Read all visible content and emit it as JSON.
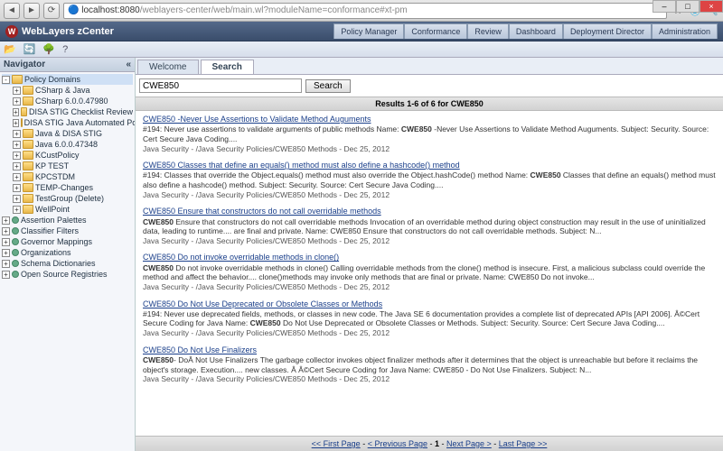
{
  "browser": {
    "url_host": "localhost:8080",
    "url_path": "/weblayers-center/web/main.wl?moduleName=conformance#xt-pm"
  },
  "app": {
    "title": "WebLayers zCenter",
    "tabs": [
      "Policy Manager",
      "Conformance",
      "Review",
      "Dashboard",
      "Deployment Director",
      "Administration"
    ]
  },
  "sidebar": {
    "title": "Navigator",
    "root": "Policy Domains",
    "items": [
      "CSharp & Java",
      "CSharp 6.0.0.47980",
      "DISA STIG Checklist Review",
      "DISA STIG Java Automated Policies v",
      "Java & DISA STIG",
      "Java 6.0.0.47348",
      "KCustPolicy",
      "KP TEST",
      "KPCSTDM",
      "TEMP-Changes",
      "TestGroup (Delete)",
      "WellPoint"
    ],
    "bottom": [
      "Assertion Palettes",
      "Classifier Filters",
      "Governor Mappings",
      "Organizations",
      "Schema Dictionaries",
      "Open Source Registries"
    ]
  },
  "content": {
    "tabs": {
      "welcome": "Welcome",
      "search": "Search"
    },
    "search_value": "CWE850",
    "search_btn": "Search",
    "results_header": "Results 1-6 of 6 for CWE850",
    "results": [
      {
        "title": "CWE850 -Never Use Assertions to Validate Method Auguments",
        "summary_pre": "#194: Never use assertions to validate arguments of public methods Name: ",
        "summary_bold": "CWE850",
        "summary_post": " -Never Use Assertions to Validate Method Auguments. Subject: Security. Source: Cert Secure Java Coding....",
        "path": "Java Security - /Java Security Policies/CWE850 Methods - Dec 25, 2012"
      },
      {
        "title": "CWE850 Classes that define an equals() method must also define a hashcode() method",
        "summary_pre": "#194: Classes that override the Object.equals() method must also override the Object.hashCode() method Name: ",
        "summary_bold": "CWE850",
        "summary_post": " Classes that define an equals() method must also define a hashcode() method. Subject: Security. Source: Cert Secure Java Coding....",
        "path": "Java Security - /Java Security Policies/CWE850 Methods - Dec 25, 2012"
      },
      {
        "title": "CWE850 Ensure that constructors do not call overridable methods",
        "summary_pre": "",
        "summary_bold": "CWE850",
        "summary_post": " Ensure that constructors do not call overridable methods Invocation of an overridable method during object construction may result in the use of uninitialized data, leading to runtime.... are final and private. Name: CWE850 Ensure that constructors do not call overridable methods. Subject: N...",
        "path": "Java Security - /Java Security Policies/CWE850 Methods - Dec 25, 2012"
      },
      {
        "title": "CWE850 Do not invoke overridable methods in clone()",
        "summary_pre": "",
        "summary_bold": "CWE850",
        "summary_post": " Do not invoke overridable methods in clone() Calling overridable methods from the clone() method is insecure. First, a malicious subclass could override the method and affect the behavior.... clone()methods may invoke only methods that are final or private. Name: CWE850 Do not invoke...",
        "path": "Java Security - /Java Security Policies/CWE850 Methods - Dec 25, 2012"
      },
      {
        "title": "CWE850 Do Not Use Deprecated or Obsolete Classes or Methods",
        "summary_pre": "#194: Never use deprecated fields, methods, or classes in new code. The Java SE 6 documentation provides a complete list of deprecated APIs [API 2006]. Â©Cert Secure Coding for Java Name: ",
        "summary_bold": "CWE850",
        "summary_post": " Do Not Use Deprecated or Obsolete Classes or Methods. Subject: Security. Source: Cert Secure Java Coding....",
        "path": "Java Security - /Java Security Policies/CWE850 Methods - Dec 25, 2012"
      },
      {
        "title": "CWE850 Do Not Use Finalizers",
        "summary_pre": "",
        "summary_bold": "CWE850",
        "summary_post": "- DoÂ Not Use Finalizers The garbage collector invokes object finalizer methods after it determines that the object is unreachable but before it reclaims the object's storage. Execution.... new classes. Â Â©Cert Secure Coding for Java Name: CWE850 - Do Not Use Finalizers. Subject: N...",
        "path": "Java Security - /Java Security Policies/CWE850 Methods - Dec 25, 2012"
      }
    ],
    "pager": {
      "first": "<< First Page",
      "prev": "< Previous Page",
      "current": "1",
      "next": "Next Page >",
      "last": "Last Page >>"
    }
  }
}
